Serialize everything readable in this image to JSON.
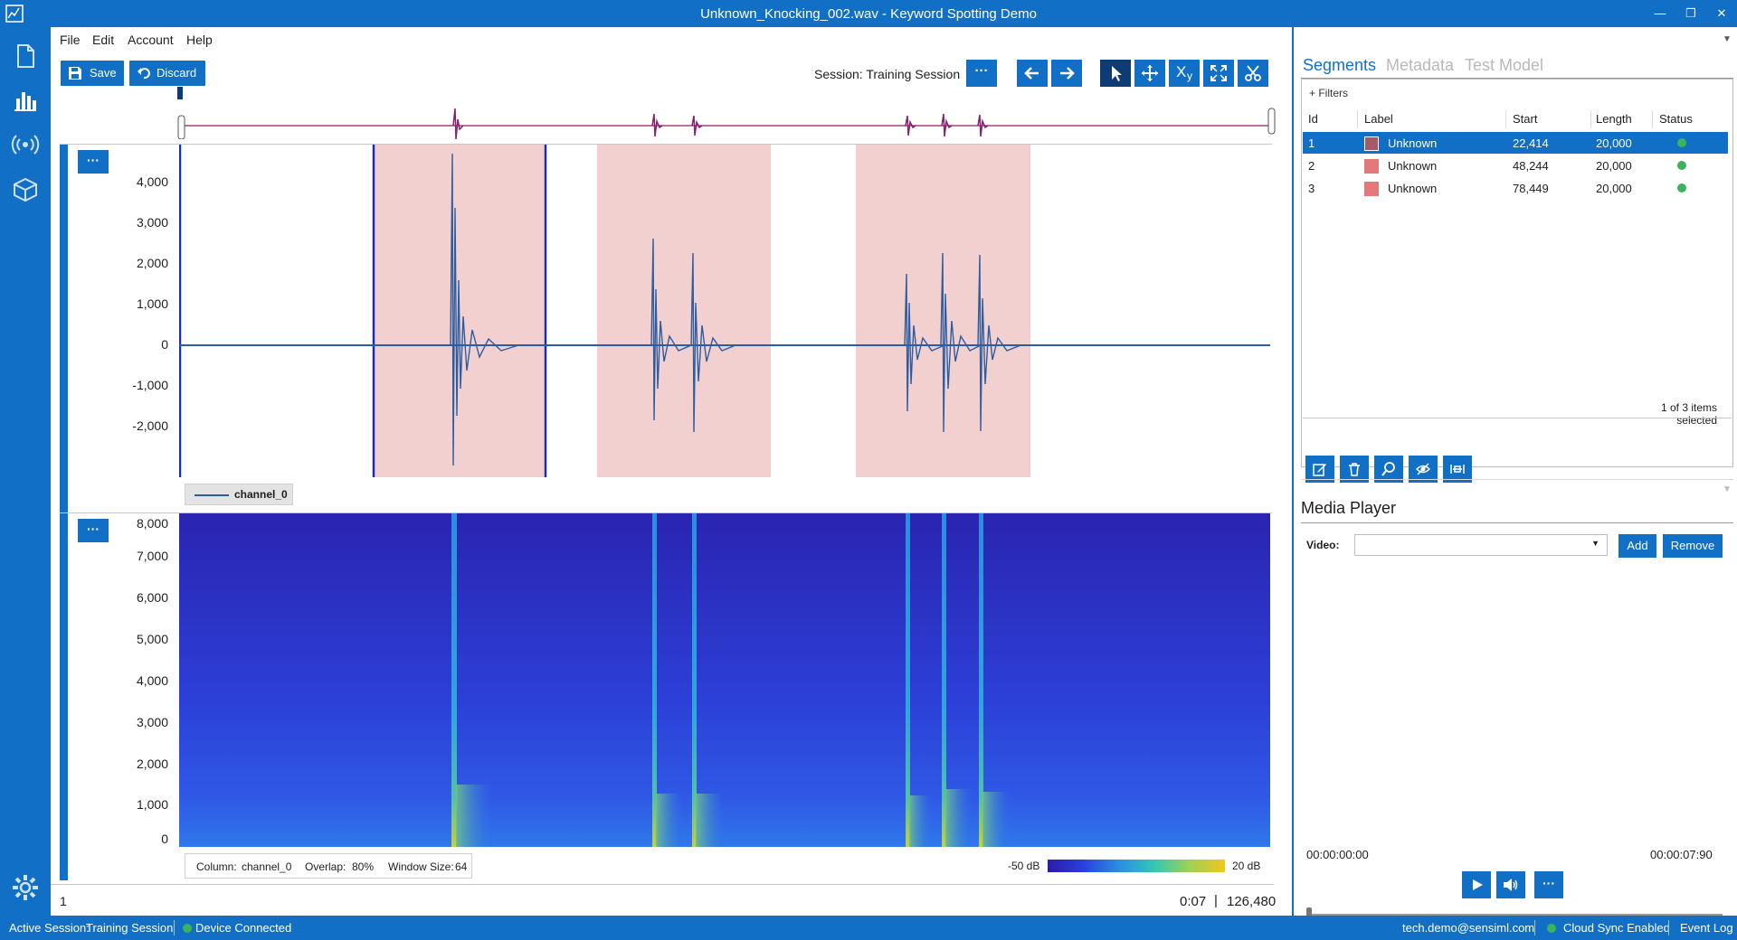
{
  "window": {
    "title": "Unknown_Knocking_002.wav - Keyword Spotting Demo",
    "minimize_glyph": "—",
    "restore_glyph": "❐",
    "close_glyph": "✕"
  },
  "left_rail": {
    "icons": [
      "document-icon",
      "bar-chart-icon",
      "broadcast-icon",
      "cube-icon",
      "settings-icon"
    ]
  },
  "menu": {
    "items": [
      "File",
      "Edit",
      "Account",
      "Help"
    ]
  },
  "toolbar": {
    "save_label": "Save",
    "discard_label": "Discard",
    "session_label": "Session:",
    "session_value": "Training Session",
    "more_label": "···",
    "xy_label": "X",
    "xy_sub": "y"
  },
  "waveform": {
    "y_ticks": [
      "4,000",
      "3,000",
      "2,000",
      "1,000",
      "0",
      "-1,000",
      "-2,000"
    ],
    "legend": "channel_0",
    "signal_color": "#2e5c9e",
    "segment_fill": "#f2d0d0",
    "overview_color": "#8a1f6e"
  },
  "spectrogram": {
    "y_ticks": [
      "8,000",
      "7,000",
      "6,000",
      "5,000",
      "4,000",
      "3,000",
      "2,000",
      "1,000",
      "0"
    ],
    "column_label": "Column:",
    "column_value": "channel_0",
    "overlap_label": "Overlap:",
    "overlap_value": "80%",
    "window_label": "Window Size:",
    "window_value": "64",
    "min_db": "-50 dB",
    "max_db": "20 dB"
  },
  "main_status": {
    "page": "1",
    "time": "0:07",
    "separator": "|",
    "samples": "126,480"
  },
  "segments_pane": {
    "tabs": [
      "Segments",
      "Metadata",
      "Test Model"
    ],
    "filters_label": "+ Filters",
    "columns": [
      "Id",
      "Label",
      "Start",
      "Length",
      "Status"
    ],
    "rows": [
      {
        "id": "1",
        "label": "Unknown",
        "start": "22,414",
        "length": "20,000",
        "swatch": "#a5596b"
      },
      {
        "id": "2",
        "label": "Unknown",
        "start": "48,244",
        "length": "20,000",
        "swatch": "#e27a7a"
      },
      {
        "id": "3",
        "label": "Unknown",
        "start": "78,449",
        "length": "20,000",
        "swatch": "#e27a7a"
      }
    ],
    "selection_text": "1 of 3 items selected",
    "selected_row_color": "#1170c6"
  },
  "media_player": {
    "title": "Media Player",
    "video_label": "Video:",
    "add_label": "Add",
    "remove_label": "Remove",
    "time_start": "00:00:00:00",
    "time_end": "00:00:07:90",
    "more_label": "···"
  },
  "statusbar": {
    "active_session_label": "Active Session:",
    "active_session_value": "Training Session",
    "device_status": "Device Connected",
    "user": "tech.demo@sensiml.com",
    "cloud_status": "Cloud Sync Enabled",
    "event_log": "Event Log"
  }
}
